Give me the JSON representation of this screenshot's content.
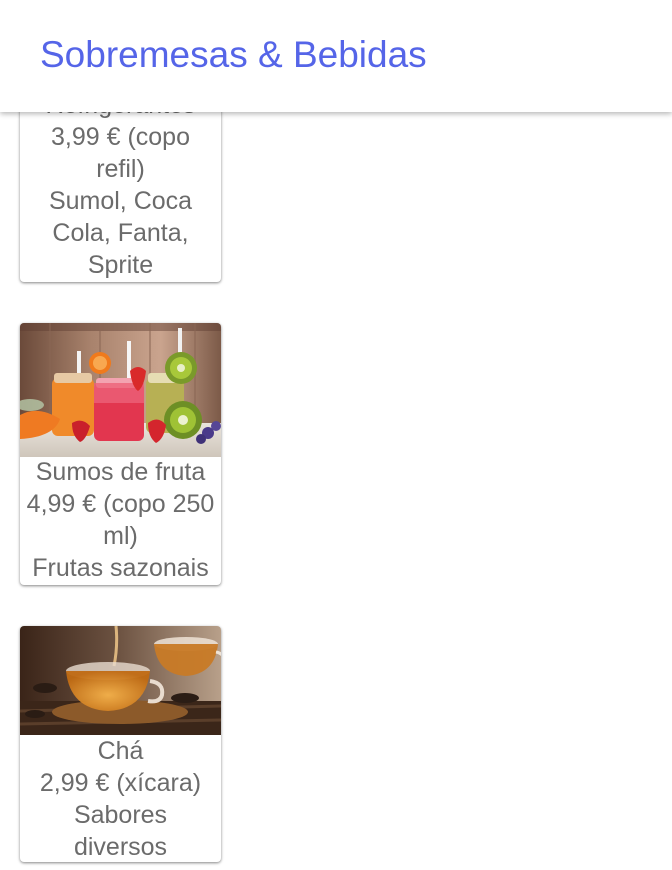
{
  "header": {
    "title": "Sobremesas & Bebidas"
  },
  "cards": [
    {
      "name": "Refrigerantes",
      "price": "3,99 € (copo refil)",
      "description": "Sumol, Coca Cola, Fanta, Sprite"
    },
    {
      "name": "Sumos de fruta",
      "price": "4,99 € (copo 250 ml)",
      "description": "Frutas sazonais",
      "image": "fruit-juice-jars-photo"
    },
    {
      "name": "Chá",
      "price": "2,99 € (xícara)",
      "description": "Sabores diversos",
      "image": "tea-cups-photo"
    }
  ],
  "colors": {
    "title": "#5565e8",
    "card_text": "#6b6b6b",
    "background": "#ffffff"
  }
}
